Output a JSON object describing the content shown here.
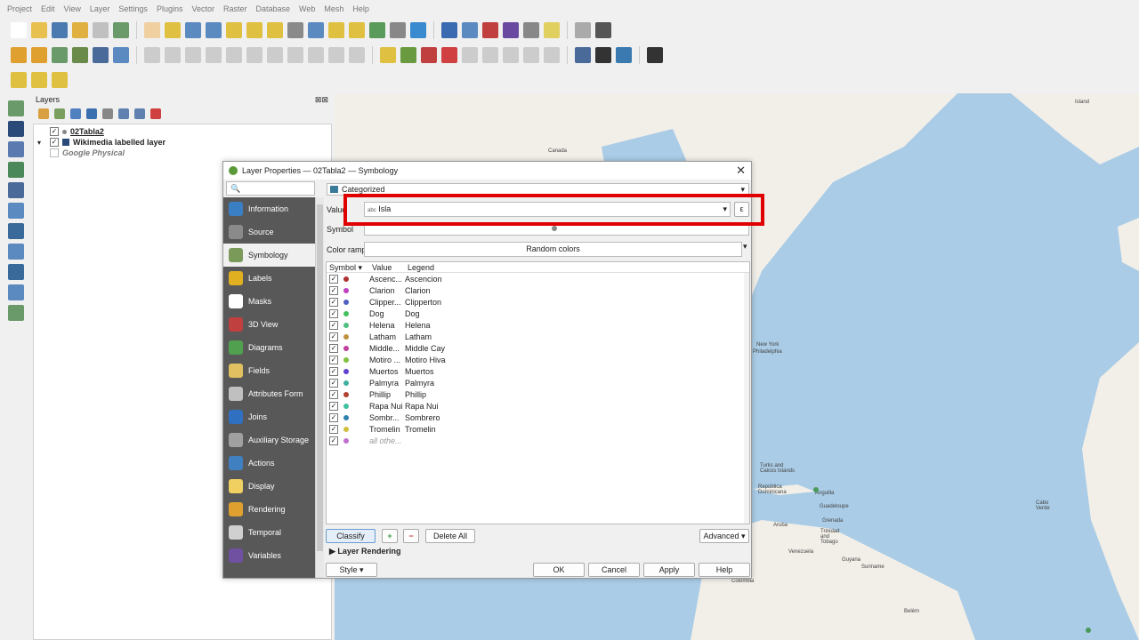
{
  "menubar": [
    "Project",
    "Edit",
    "View",
    "Layer",
    "Settings",
    "Plugins",
    "Vector",
    "Raster",
    "Database",
    "Web",
    "Mesh",
    "Help"
  ],
  "layers_panel": {
    "title": "Layers",
    "close_glyph": "⊠⊠",
    "items": [
      {
        "label": "02Tabla2",
        "checked": "✓",
        "expand": ""
      },
      {
        "label": "Wikimedia labelled layer",
        "checked": "✓",
        "expand": "▾"
      },
      {
        "label": "Google Physical",
        "checked": "",
        "expand": ""
      }
    ]
  },
  "map_labels": [
    "Island",
    "Canada",
    "New York",
    "Philadelphia",
    "Turks and Caicos Islands",
    "República Dominicana",
    "Anguilla",
    "Guadeloupe",
    "Aruba",
    "Grenada",
    "Trinidad and Tobago",
    "Venezuela",
    "Guyana",
    "Suriname",
    "Cabo Verde",
    "Belém",
    "Colombia"
  ],
  "dialog": {
    "title": "Layer Properties — 02Tabla2 — Symbology",
    "close": "✕",
    "search_glyph": "🔍",
    "renderer": "Categorized",
    "value_label": "Value",
    "value_type": "abc",
    "value_field": "Isla",
    "epsilon": "ε",
    "symbol_label": "Symbol",
    "color_ramp_label": "Color ramp",
    "color_ramp_value": "Random colors",
    "nav": [
      {
        "label": "Information",
        "color": "#3a7fc4"
      },
      {
        "label": "Source",
        "color": "#8a8a8a"
      },
      {
        "label": "Symbology",
        "color": "#7a9a5a"
      },
      {
        "label": "Labels",
        "color": "#e0b020"
      },
      {
        "label": "Masks",
        "color": "#ffffff"
      },
      {
        "label": "3D View",
        "color": "#c04040"
      },
      {
        "label": "Diagrams",
        "color": "#50a050"
      },
      {
        "label": "Fields",
        "color": "#e0c060"
      },
      {
        "label": "Attributes Form",
        "color": "#c0c0c0"
      },
      {
        "label": "Joins",
        "color": "#3070c0"
      },
      {
        "label": "Auxiliary Storage",
        "color": "#a0a0a0"
      },
      {
        "label": "Actions",
        "color": "#4080c0"
      },
      {
        "label": "Display",
        "color": "#f0d060"
      },
      {
        "label": "Rendering",
        "color": "#e0a030"
      },
      {
        "label": "Temporal",
        "color": "#d0d0d0"
      },
      {
        "label": "Variables",
        "color": "#7050a0"
      }
    ],
    "table_headers": {
      "symbol": "Symbol",
      "value": "Value",
      "legend": "Legend"
    },
    "rows": [
      {
        "value": "Ascenc...",
        "legend": "Ascencion",
        "color": "#b03030"
      },
      {
        "value": "Clarion",
        "legend": "Clarion",
        "color": "#c040c0"
      },
      {
        "value": "Clipper...",
        "legend": "Clipperton",
        "color": "#5060c0"
      },
      {
        "value": "Dog",
        "legend": "Dog",
        "color": "#40c060"
      },
      {
        "value": "Helena",
        "legend": "Helena",
        "color": "#50c080"
      },
      {
        "value": "Latham",
        "legend": "Latham",
        "color": "#c09040"
      },
      {
        "value": "Middle...",
        "legend": "Middle Cay",
        "color": "#c040a0"
      },
      {
        "value": "Motiro ...",
        "legend": "Motiro Hiva",
        "color": "#80c040"
      },
      {
        "value": "Muertos",
        "legend": "Muertos",
        "color": "#6040d0"
      },
      {
        "value": "Palmyra",
        "legend": "Palmyra",
        "color": "#40b0a0"
      },
      {
        "value": "Phillip",
        "legend": "Phillip",
        "color": "#b04030"
      },
      {
        "value": "Rapa Nui",
        "legend": "Rapa Nui",
        "color": "#40c0a0"
      },
      {
        "value": "Sombr...",
        "legend": "Sombrero",
        "color": "#3080b0"
      },
      {
        "value": "Tromelin",
        "legend": "Tromelin",
        "color": "#d0c040"
      },
      {
        "value": "all othe...",
        "legend": "",
        "color": "#c070d0"
      }
    ],
    "buttons": {
      "classify": "Classify",
      "add": "+",
      "remove": "−",
      "delete_all": "Delete All",
      "advanced": "Advanced",
      "layer_rendering": "Layer Rendering",
      "style": "Style",
      "ok": "OK",
      "cancel": "Cancel",
      "apply": "Apply",
      "help": "Help"
    }
  }
}
